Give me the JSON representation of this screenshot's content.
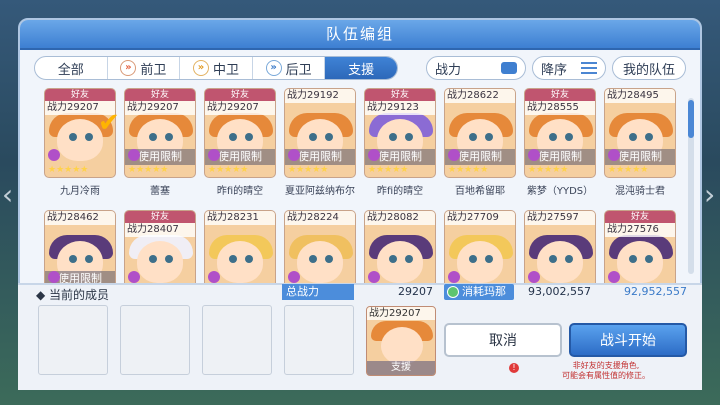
{
  "title": "队伍编组",
  "tabs": [
    {
      "label": "全部",
      "active": false
    },
    {
      "label": "前卫",
      "active": false
    },
    {
      "label": "中卫",
      "active": false
    },
    {
      "label": "后卫",
      "active": false
    },
    {
      "label": "支援",
      "active": true
    }
  ],
  "controls": {
    "sort_key": "战力",
    "order": "降序",
    "my_team": "我的队伍"
  },
  "cards": [
    {
      "friend": "好友",
      "power": "战力29207",
      "restrict": "",
      "name": "九月冷雨",
      "hair": "#e6893a",
      "selected": true
    },
    {
      "friend": "好友",
      "power": "战力29207",
      "restrict": "使用限制",
      "name": "蕾塞",
      "hair": "#e6893a"
    },
    {
      "friend": "好友",
      "power": "战力29207",
      "restrict": "使用限制",
      "name": "昨fi的晴空",
      "hair": "#e6893a"
    },
    {
      "friend": "",
      "power": "战力29192",
      "restrict": "使用限制",
      "name": "夏亚阿兹纳布尔",
      "hair": "#e6893a"
    },
    {
      "friend": "好友",
      "power": "战力29123",
      "restrict": "使用限制",
      "name": "昨fi的晴空",
      "hair": "#8b6bd4"
    },
    {
      "friend": "",
      "power": "战力28622",
      "restrict": "使用限制",
      "name": "百地希留耶",
      "hair": "#e6893a"
    },
    {
      "friend": "好友",
      "power": "战力28555",
      "restrict": "使用限制",
      "name": "紫梦（YYDS）",
      "hair": "#e6893a"
    },
    {
      "friend": "",
      "power": "战力28495",
      "restrict": "使用限制",
      "name": "混沌骑士君",
      "hair": "#e6893a"
    },
    {
      "friend": "",
      "power": "战力28462",
      "restrict": "使用限制",
      "name": "",
      "hair": "#5a3b7a"
    },
    {
      "friend": "好友",
      "power": "战力28407",
      "restrict": "",
      "name": "",
      "hair": "#f0eef5"
    },
    {
      "friend": "",
      "power": "战力28231",
      "restrict": "",
      "name": "",
      "hair": "#f3c85a"
    },
    {
      "friend": "",
      "power": "战力28224",
      "restrict": "",
      "name": "",
      "hair": "#f0c060"
    },
    {
      "friend": "",
      "power": "战力28082",
      "restrict": "",
      "name": "",
      "hair": "#5a3b7a"
    },
    {
      "friend": "",
      "power": "战力27709",
      "restrict": "",
      "name": "",
      "hair": "#f3c85a"
    },
    {
      "friend": "",
      "power": "战力27597",
      "restrict": "",
      "name": "",
      "hair": "#5a3b7a"
    },
    {
      "friend": "好友",
      "power": "战力27576",
      "restrict": "",
      "name": "",
      "hair": "#5a3b7a"
    }
  ],
  "bottom": {
    "current_members": "当前的成员",
    "total_power_label": "总战力",
    "total_power_value": "29207",
    "mana_label": "消耗玛那",
    "mana_have": "93,002,557",
    "mana_after": "92,952,557",
    "support_power": "战力29207",
    "support_label": "支援",
    "cancel": "取消",
    "start": "战斗开始",
    "warning_line1": "非好友的支援角色,",
    "warning_line2": "可能会有属性值的修正。"
  }
}
